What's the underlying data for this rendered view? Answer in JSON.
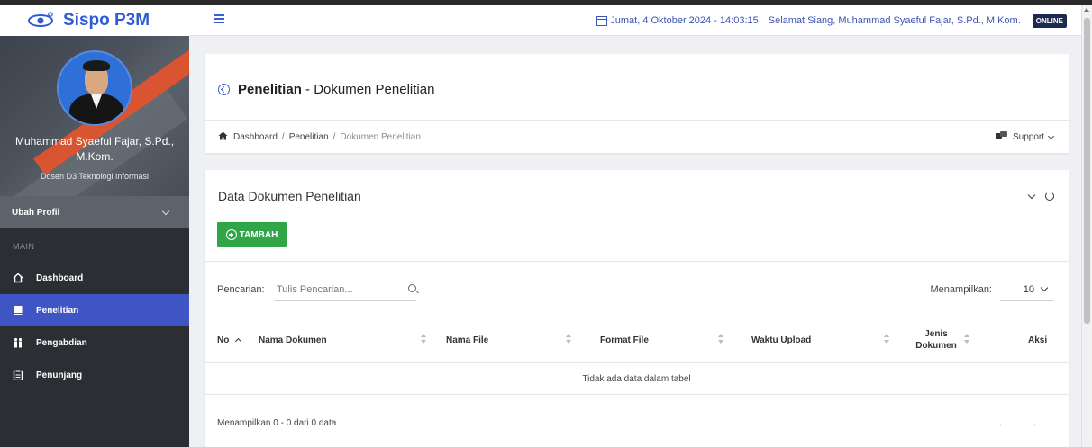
{
  "app": {
    "brand": "Sispo P3M"
  },
  "topbar": {
    "datetime": "Jumat, 4 Oktober 2024 - 14:03:15",
    "greeting": "Selamat Siang, Muhammad Syaeful Fajar, S.Pd., M.Kom.",
    "status_badge": "ONLINE"
  },
  "profile": {
    "name": "Muhammad Syaeful Fajar, S.Pd., M.Kom.",
    "role": "Dosen D3 Teknologi Informasi",
    "edit_label": "Ubah Profil"
  },
  "sidebar": {
    "section_label": "MAIN",
    "items": [
      {
        "label": "Dashboard",
        "icon": "home-icon",
        "active": false
      },
      {
        "label": "Penelitian",
        "icon": "book-icon",
        "active": true
      },
      {
        "label": "Pengabdian",
        "icon": "people-icon",
        "active": false
      },
      {
        "label": "Penunjang",
        "icon": "clipboard-icon",
        "active": false
      }
    ]
  },
  "header": {
    "title_bold": "Penelitian",
    "title_rest": " - Dokumen Penelitian",
    "breadcrumb": [
      "Dashboard",
      "Penelitian",
      "Dokumen Penelitian"
    ],
    "breadcrumb_sep": "/",
    "support_label": "Support"
  },
  "data_card": {
    "title": "Data Dokumen Penelitian",
    "add_button": "TAMBAH",
    "search_label": "Pencarian:",
    "search_placeholder": "Tulis Pencarian...",
    "show_label": "Menampilkan:",
    "page_size": "10",
    "columns": [
      "No",
      "Nama Dokumen",
      "Nama File",
      "Format File",
      "Waktu Upload",
      "Jenis Dokumen",
      "Aksi"
    ],
    "empty_message": "Tidak ada data dalam tabel",
    "footer_info": "Menampilkan 0 - 0 dari 0 data",
    "pager": "← →"
  },
  "colors": {
    "brand": "#2d5bd7",
    "sidebar_bg": "#2b2e33",
    "active_item": "#4055c4",
    "add_button": "#30a648",
    "online_badge": "#1d2a4f"
  }
}
